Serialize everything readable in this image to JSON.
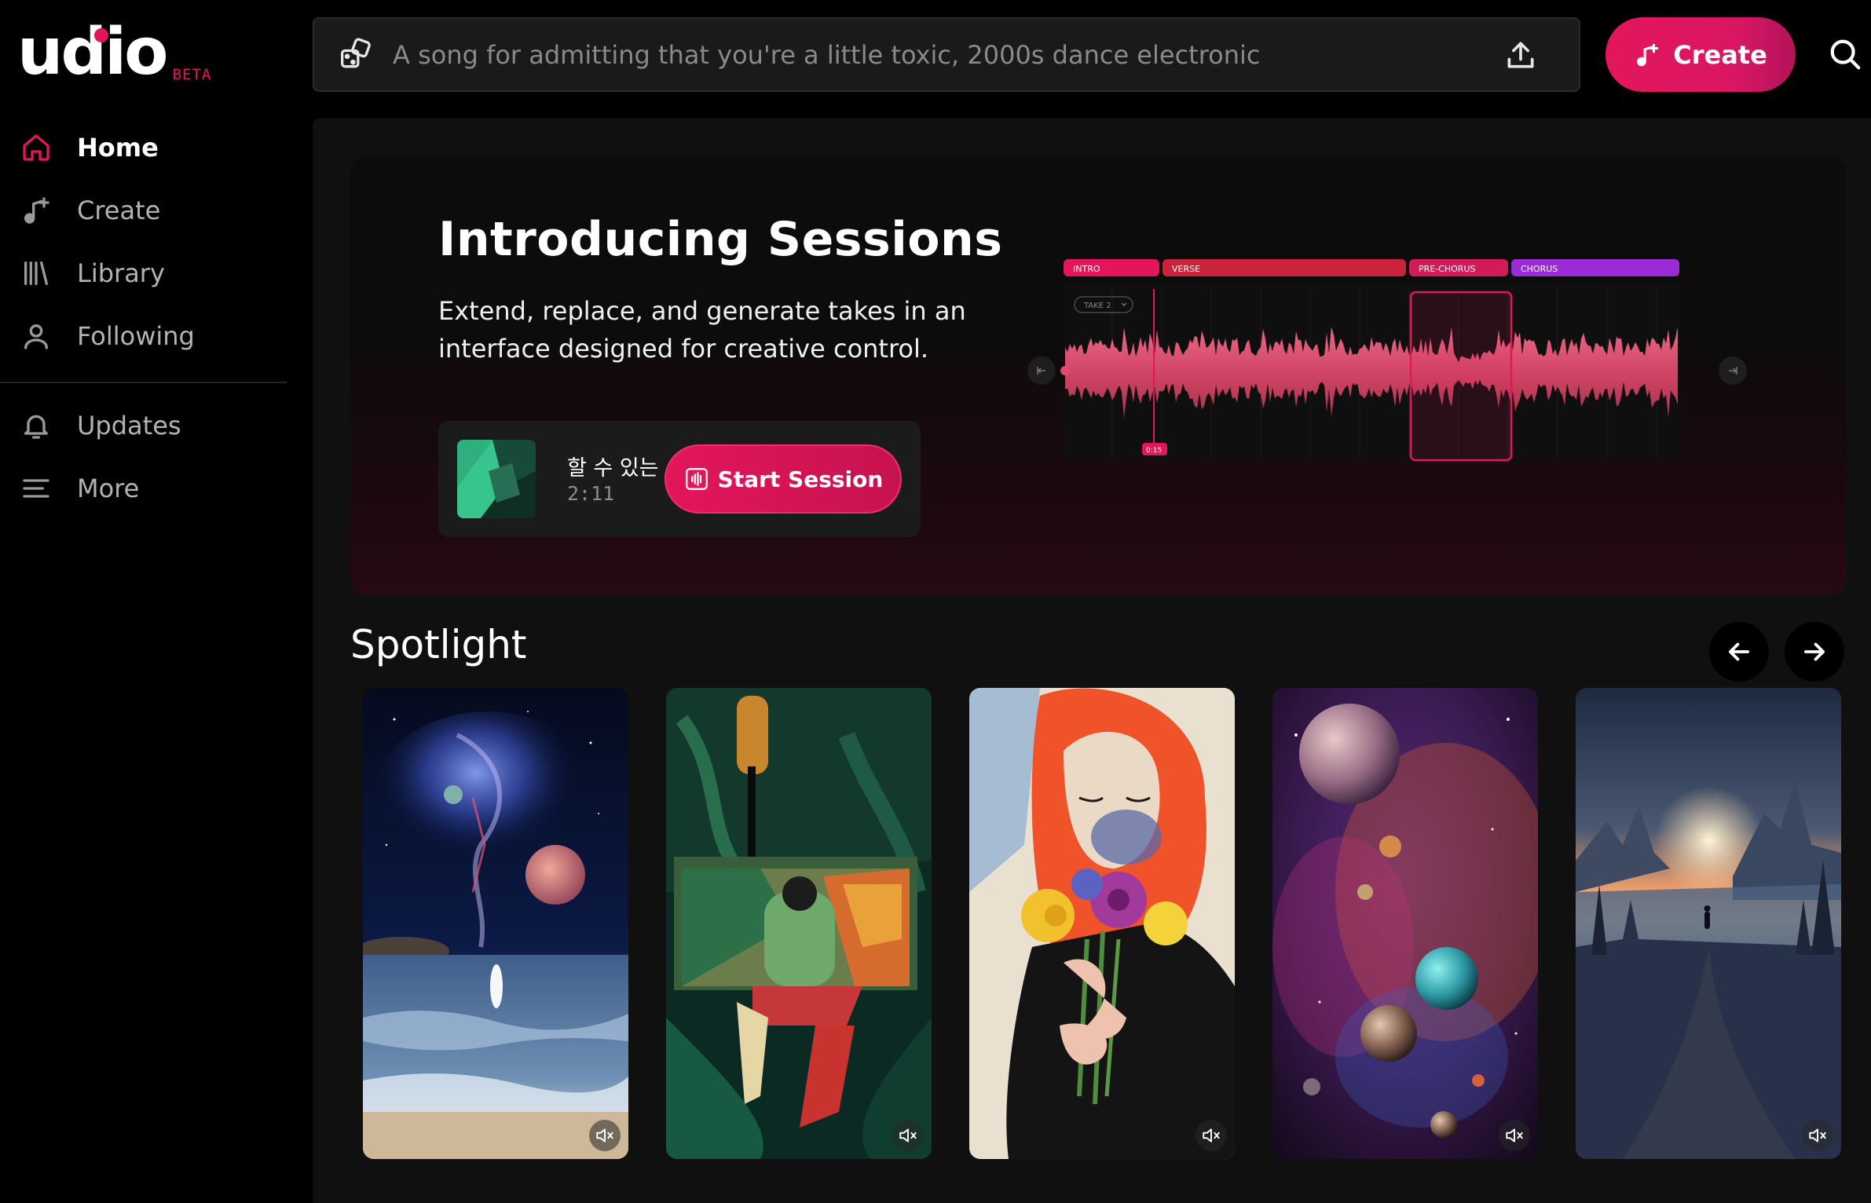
{
  "brand": {
    "logo_text": "udio",
    "beta_label": "BETA",
    "accent": "#e3165b"
  },
  "sidebar": {
    "items": [
      {
        "label": "Home",
        "icon": "home-icon",
        "active": true
      },
      {
        "label": "Create",
        "icon": "music-plus-icon"
      },
      {
        "label": "Library",
        "icon": "library-icon"
      },
      {
        "label": "Following",
        "icon": "user-icon"
      },
      {
        "label": "Updates",
        "icon": "bell-icon"
      },
      {
        "label": "More",
        "icon": "menu-lines-icon"
      }
    ]
  },
  "topbar": {
    "prompt_placeholder": "A song for admitting that you're a little toxic, 2000s dance electronic",
    "create_label": "Create"
  },
  "hero": {
    "title": "Introducing Sessions",
    "description": "Extend, replace, and generate takes in an interface designed for creative control.",
    "song_title": "할 수 있는",
    "song_duration": "2:11",
    "start_label": "Start Session",
    "waveform": {
      "sections": [
        "INTRO",
        "VERSE",
        "PRE-CHORUS",
        "CHORUS"
      ],
      "section_colors": [
        "#e3165b",
        "#c9243b",
        "#d01c58",
        "#9b2bd6"
      ],
      "take_label": "TAKE 2",
      "playhead_time": "0:15"
    }
  },
  "spotlight": {
    "title": "Spotlight",
    "cards": [
      {
        "art": "cosmic-beach-art"
      },
      {
        "art": "painted-figure-art"
      },
      {
        "art": "red-hair-bouquet-art"
      },
      {
        "art": "planets-nebula-art"
      },
      {
        "art": "mountain-sunset-art"
      }
    ]
  }
}
